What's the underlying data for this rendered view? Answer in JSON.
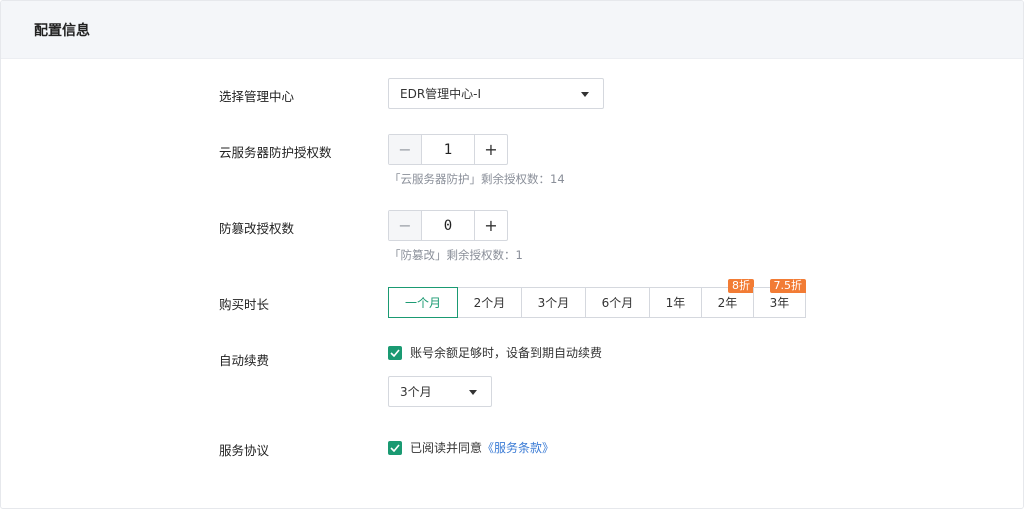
{
  "header": {
    "title": "配置信息"
  },
  "management_center": {
    "label": "选择管理中心",
    "selected": "EDR管理中心-I"
  },
  "cloud_server_licenses": {
    "label": "云服务器防护授权数",
    "value": "1",
    "minus": "−",
    "plus": "+",
    "hint": "「云服务器防护」剩余授权数：14"
  },
  "tamper_licenses": {
    "label": "防篡改授权数",
    "value": "0",
    "minus": "−",
    "plus": "+",
    "hint": "「防篡改」剩余授权数：1"
  },
  "duration": {
    "label": "购买时长",
    "options": [
      {
        "label": "一个月",
        "active": true,
        "badge": ""
      },
      {
        "label": "2个月",
        "active": false,
        "badge": ""
      },
      {
        "label": "3个月",
        "active": false,
        "badge": ""
      },
      {
        "label": "6个月",
        "active": false,
        "badge": ""
      },
      {
        "label": "1年",
        "active": false,
        "badge": ""
      },
      {
        "label": "2年",
        "active": false,
        "badge": "8折"
      },
      {
        "label": "3年",
        "active": false,
        "badge": "7.5折"
      }
    ]
  },
  "auto_renew": {
    "label": "自动续费",
    "checked": true,
    "checkbox_text": "账号余额足够时，设备到期自动续费",
    "period_selected": "3个月"
  },
  "agreement": {
    "label": "服务协议",
    "checked": true,
    "text": "已阅读并同意",
    "link_text": "《服务条款》"
  },
  "colors": {
    "accent": "#1a9a72",
    "discount": "#f27c35",
    "link": "#3a7bd5"
  }
}
